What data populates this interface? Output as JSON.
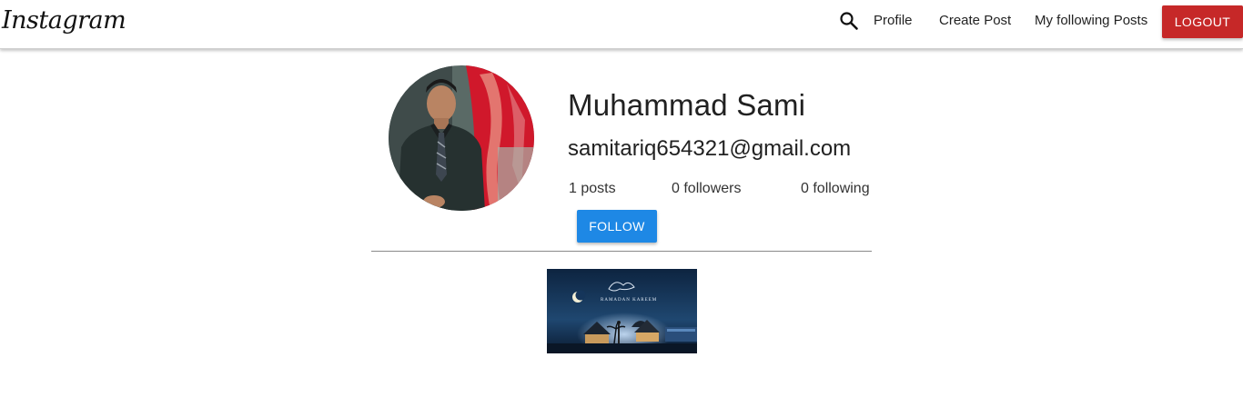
{
  "navbar": {
    "logo": "Instagram",
    "search_icon": "search-icon",
    "links": {
      "profile": "Profile",
      "create_post": "Create Post",
      "following_posts": "My following Posts"
    },
    "logout_label": "LOGOUT",
    "logout_color": "#c62828"
  },
  "profile": {
    "name": "Muhammad Sami",
    "email": "samitariq654321@gmail.com",
    "stats": {
      "posts": "1 posts",
      "followers": "0 followers",
      "following": "0 following"
    },
    "follow_label": "FOLLOW",
    "follow_color": "#1e88e5"
  },
  "gallery": {
    "posts": [
      {
        "caption_art": "RAMADAN KAREEM"
      }
    ]
  }
}
